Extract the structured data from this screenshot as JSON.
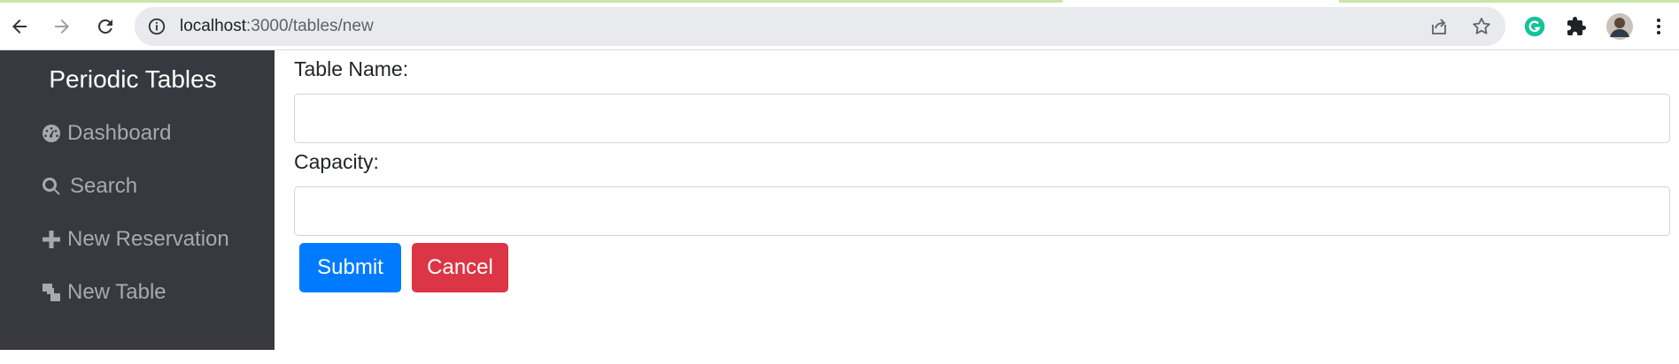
{
  "browser": {
    "url_host": "localhost",
    "url_path": ":3000/tables/new",
    "icons": [
      "back-arrow-icon",
      "forward-arrow-icon",
      "reload-icon",
      "site-info-icon",
      "share-icon",
      "bookmark-star-icon",
      "grammarly-extension-icon",
      "extensions-puzzle-icon",
      "profile-avatar",
      "menu-kebab-icon"
    ]
  },
  "sidebar": {
    "brand": "Periodic Tables",
    "items": [
      {
        "label": "Dashboard",
        "icon": "dashboard-icon"
      },
      {
        "label": "Search",
        "icon": "search-icon"
      },
      {
        "label": "New Reservation",
        "icon": "plus-icon"
      },
      {
        "label": "New Table",
        "icon": "layers-icon"
      }
    ]
  },
  "form": {
    "table_name_label": "Table Name:",
    "table_name_value": "",
    "capacity_label": "Capacity:",
    "capacity_value": "",
    "submit_label": "Submit",
    "cancel_label": "Cancel"
  },
  "colors": {
    "sidebar_bg": "#383841",
    "submit": "#007bff",
    "cancel": "#dc3545"
  }
}
